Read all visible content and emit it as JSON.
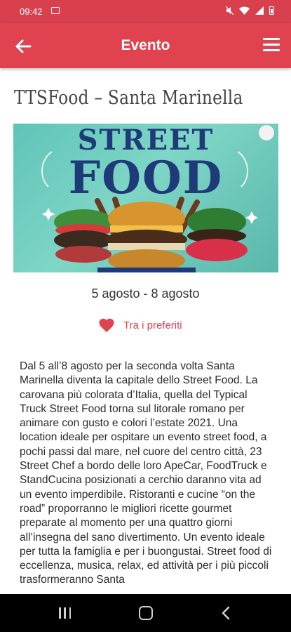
{
  "status_bar": {
    "time": "09:42"
  },
  "app_bar": {
    "title": "Evento"
  },
  "event": {
    "title": "TTSFood – Santa Marinella",
    "banner": {
      "line1": "STREET",
      "line2": "FOOD"
    },
    "dates": "5 agosto - 8 agosto",
    "favorite_label": "Tra i preferiti",
    "description": "Dal 5 all’8 agosto per la seconda volta Santa Marinella diventa la capitale dello Street Food. La carovana più colorata d’Italia, quella del Typical Truck Street Food torna sul litorale romano per animare con gusto e colori l’estate 2021. Una location ideale per ospitare un evento street food, a pochi passi dal mare, nel cuore del centro città, 23 Street Chef a bordo delle loro ApeCar, FoodTruck e StandCucina posizionati a cerchio daranno vita ad un evento imperdibile. Ristoranti e cucine “on the road” proporranno le migliori ricette gourmet preparate al momento per una quattro giorni all’insegna del sano divertimento. Un evento ideale per tutta la famiglia e per i buongustai. Street food di eccellenza, musica, relax, ed attività per i più piccoli trasformeranno Santa"
  },
  "colors": {
    "primary": "#e0424f",
    "status_bar": "#d8404e"
  },
  "icons": {
    "back": "arrow-left-icon",
    "menu": "hamburger-menu-icon",
    "favorite": "heart-icon"
  }
}
